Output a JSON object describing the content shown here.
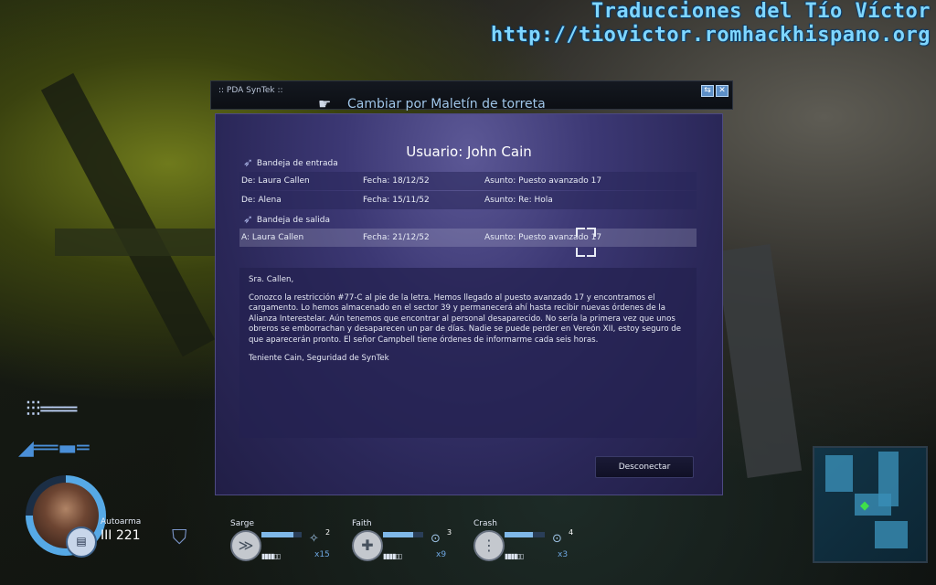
{
  "watermark": {
    "line1": "Traducciones del Tío Víctor",
    "line2": "http://tiovictor.romhackhispano.org"
  },
  "pda": {
    "title": ":: PDA SynTek ::",
    "window_buttons": [
      "restore-icon",
      "close-icon"
    ]
  },
  "pickup_prompt": "Cambiar por Maletín de torreta",
  "panel": {
    "user_title": "Usuario: John Cain",
    "inbox": {
      "heading": "Bandeja de entrada",
      "rows": [
        {
          "from": "De: Laura Callen",
          "date": "Fecha: 18/12/52",
          "subject": "Asunto: Puesto avanzado 17"
        },
        {
          "from": "De: Alena",
          "date": "Fecha: 15/11/52",
          "subject": "Asunto: Re: Hola"
        }
      ]
    },
    "outbox": {
      "heading": "Bandeja de salida",
      "rows": [
        {
          "to": "A: Laura Callen",
          "date": "Fecha: 21/12/52",
          "subject": "Asunto: Puesto avanzado 17",
          "selected": true
        }
      ]
    },
    "message": {
      "greeting": "Sra. Callen,",
      "body": "Conozco la restricción #77-C al pie de la letra. Hemos llegado al puesto avanzado 17 y encontramos el cargamento. Lo hemos almacenado en el sector 39 y permanecerá ahí hasta recibir nuevas órdenes de la Alianza Interestelar. Aún tenemos que encontrar al personal desaparecido. No sería la primera vez que unos obreros se emborrachan y desaparecen un par de días. Nadie se puede perder en Vereón XII, estoy seguro de que aparecerán pronto. El señor Campbell tiene órdenes de informarme cada seis horas.",
      "signature": "Teniente Cain, Seguridad de SynTek"
    },
    "disconnect_label": "Desconectar"
  },
  "hud": {
    "weapon_label": "Autoarma",
    "ammo": "221",
    "ammo_prefix": "III",
    "squad": [
      {
        "name": "Sarge",
        "count": "2",
        "multiplier": "x15",
        "icon": "chevron-rank-icon",
        "hp": 0.8
      },
      {
        "name": "Faith",
        "count": "3",
        "multiplier": "x9",
        "icon": "medic-cross-icon",
        "hp": 0.75
      },
      {
        "name": "Crash",
        "count": "4",
        "multiplier": "x3",
        "icon": "tech-icon",
        "hp": 0.7
      }
    ],
    "pip_text": "▮▮▮▮▯▯"
  }
}
